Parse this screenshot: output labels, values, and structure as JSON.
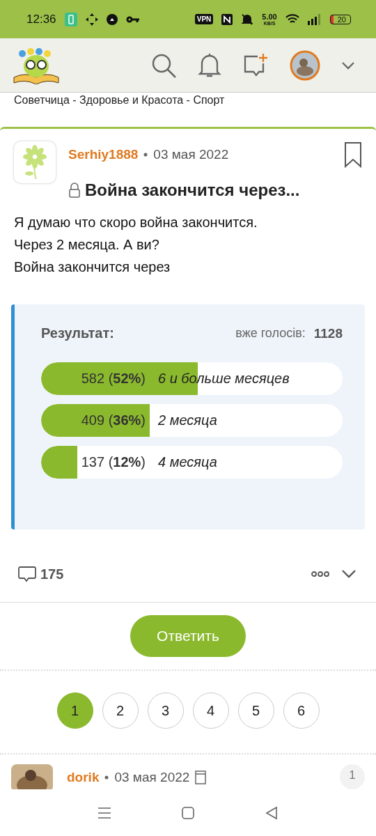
{
  "status_bar": {
    "time": "12:36",
    "vpn": "VPN",
    "speed": "5.00",
    "speed_unit": "KB/S",
    "battery": "20"
  },
  "breadcrumb": "Советчица - Здоровье и Красота - Спорт",
  "post": {
    "author": "Serhiy1888",
    "date": "03 мая 2022",
    "locked": true,
    "bookmarked": false,
    "title": "Война закончится через...",
    "body": [
      "Я думаю что скоро война закончится.",
      "Через 2 месяца. А ви?",
      "Война закончится через"
    ],
    "poll": {
      "heading": "Результат:",
      "votes_label": "вже голосів:",
      "votes_total": "1128",
      "options": [
        {
          "count": "582 (**52%**)",
          "label": "6 и больше месяцев",
          "level": 0.52
        },
        {
          "count": "409 (**36%**)",
          "label": "2 месяца",
          "level": 0.36
        },
        {
          "count": "137 (**12%**)",
          "label": "4 месяца",
          "level": 0.12
        }
      ]
    },
    "comments_count": "175"
  },
  "reply_button": "Ответить",
  "pagination": [
    {
      "label": "1",
      "selected": true
    },
    {
      "label": "2",
      "selected": false
    },
    {
      "label": "3",
      "selected": false
    },
    {
      "label": "4",
      "selected": false
    },
    {
      "label": "5",
      "selected": false
    },
    {
      "label": "6",
      "selected": false
    }
  ],
  "next_post": {
    "author": "dorik",
    "date": "03 мая 2022",
    "badge": "1"
  }
}
